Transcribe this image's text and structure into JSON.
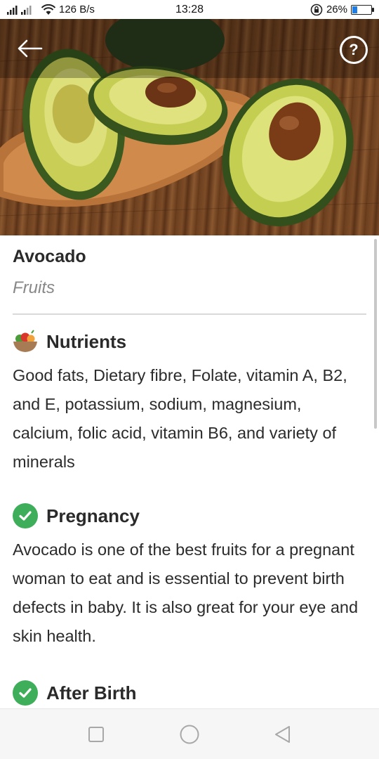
{
  "status_bar": {
    "network_speed": "126 B/s",
    "time": "13:28",
    "battery": "26%",
    "battery_level": 0.26
  },
  "hero": {
    "back_icon": "arrow-left-icon",
    "help_icon": "question-mark-icon",
    "help_symbol": "?"
  },
  "food": {
    "name": "Avocado",
    "category": "Fruits"
  },
  "sections": {
    "nutrients": {
      "title": "Nutrients",
      "icon": "fruit-bowl-icon",
      "text": "Good fats, Dietary fibre, Folate, vitamin A, B2, and E, potassium, sodium, magnesium, calcium, folic acid, vitamin B6, and variety of minerals"
    },
    "pregnancy": {
      "title": "Pregnancy",
      "icon": "check-circle-icon",
      "text": "Avocado is one of the best fruits for a pregnant woman to eat and is essential to prevent birth defects in baby. It is also great for your eye and skin health."
    },
    "after_birth": {
      "title": "After Birth",
      "icon": "check-circle-icon"
    }
  },
  "colors": {
    "check_green": "#3fae5a",
    "battery_blue": "#1e7ee6"
  },
  "nav": {
    "recent_icon": "square-icon",
    "home_icon": "circle-icon",
    "back_icon": "triangle-back-icon"
  }
}
